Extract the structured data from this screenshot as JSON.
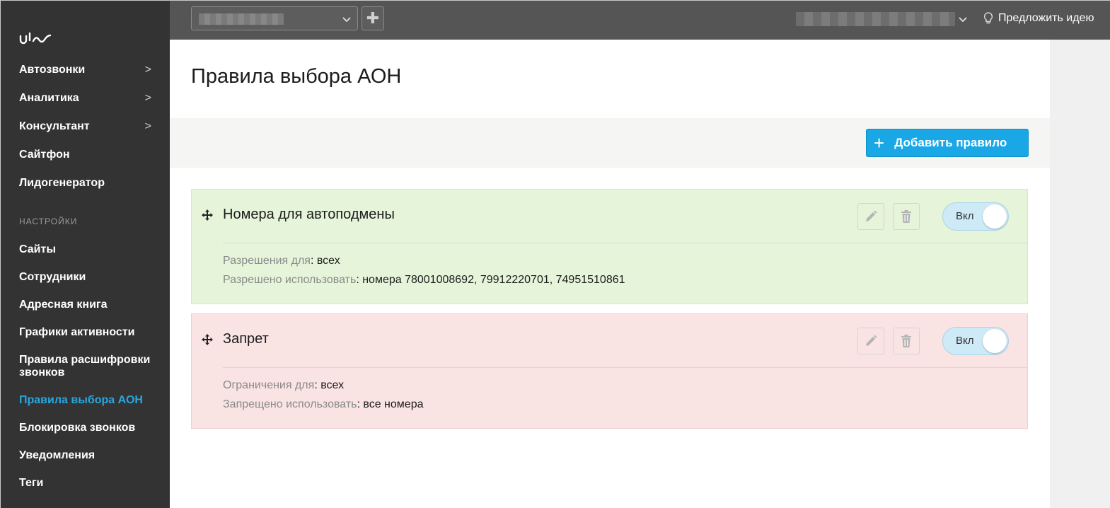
{
  "sidebar": {
    "logo": "uis-logo",
    "nav_items": [
      {
        "label": "Автозвонки",
        "has_submenu": true,
        "chevron": ">"
      },
      {
        "label": "Аналитика",
        "has_submenu": true,
        "chevron": ">"
      },
      {
        "label": "Консультант",
        "has_submenu": true,
        "chevron": ">"
      },
      {
        "label": "Сайтфон",
        "has_submenu": false
      },
      {
        "label": "Лидогенератор",
        "has_submenu": false
      }
    ],
    "settings_title": "НАСТРОЙКИ",
    "settings_items": [
      {
        "label": "Сайты"
      },
      {
        "label": "Сотрудники"
      },
      {
        "label": "Адресная книга"
      },
      {
        "label": "Графики активности"
      },
      {
        "label": "Правила расшифровки звонков"
      },
      {
        "label": "Правила выбора АОН",
        "active": true
      },
      {
        "label": "Блокировка звонков"
      },
      {
        "label": "Уведомления"
      },
      {
        "label": "Теги"
      }
    ]
  },
  "topbar": {
    "plus_label": "✚",
    "idea_label": "Предложить идею",
    "idea_icon": "lightbulb-icon"
  },
  "main": {
    "title": "Правила выбора АОН",
    "add_button_label": "Добавить правило",
    "rules": [
      {
        "title": "Номера для автоподмены",
        "status": "allow",
        "color": "#e6f4da",
        "toggle_label": "Вкл",
        "detail1_label": "Разрешения для",
        "detail1_value": ": всех",
        "detail2_label": "Разрешено использовать",
        "detail2_value": ": номера 78001008692, 79912220701, 74951510861"
      },
      {
        "title": "Запрет",
        "status": "deny",
        "color": "#fae3e3",
        "toggle_label": "Вкл",
        "detail1_label": "Ограничения для",
        "detail1_value": ": всех",
        "detail2_label": "Запрещено использовать",
        "detail2_value": ": все номера"
      }
    ]
  },
  "colors": {
    "sidebar_bg": "#333333",
    "topbar_bg": "#555555",
    "accent": "#1aa7e6",
    "active_link": "#2aa6de"
  }
}
